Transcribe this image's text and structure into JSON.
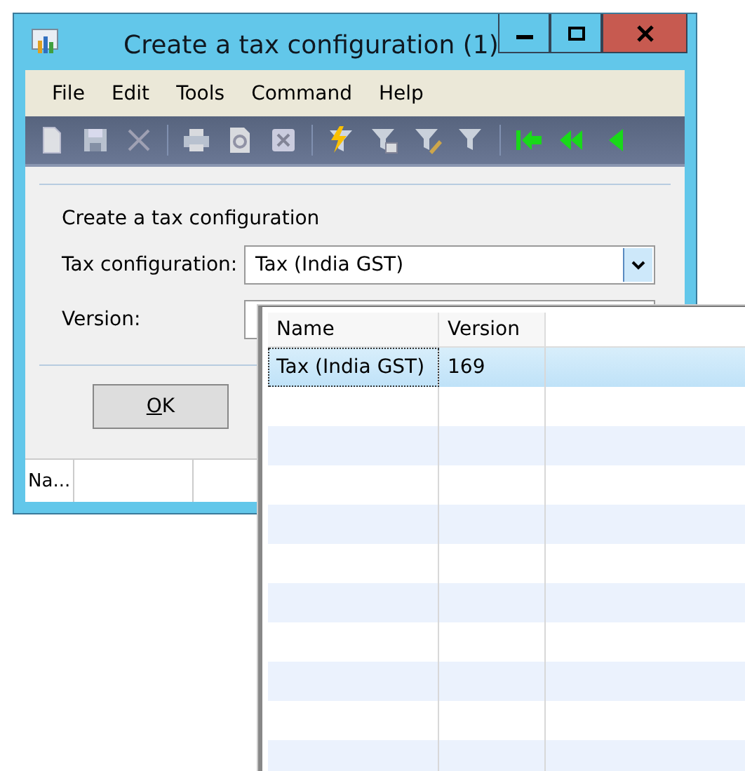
{
  "window": {
    "title": "Create a tax configuration (1)"
  },
  "menu": [
    "File",
    "Edit",
    "Tools",
    "Command",
    "Help"
  ],
  "toolbar": [
    {
      "kind": "new",
      "disabled": true
    },
    {
      "kind": "save",
      "disabled": true
    },
    {
      "kind": "delete",
      "disabled": true
    },
    {
      "kind": "sep"
    },
    {
      "kind": "print",
      "disabled": true
    },
    {
      "kind": "preview",
      "disabled": true
    },
    {
      "kind": "excel",
      "disabled": true
    },
    {
      "kind": "sep"
    },
    {
      "kind": "filter-lightning",
      "disabled": false
    },
    {
      "kind": "filter-grid",
      "disabled": true
    },
    {
      "kind": "filter-edit",
      "disabled": true
    },
    {
      "kind": "filter-clear",
      "disabled": true
    },
    {
      "kind": "sep"
    },
    {
      "kind": "first",
      "disabled": false
    },
    {
      "kind": "prev-page",
      "disabled": false
    },
    {
      "kind": "prev",
      "disabled": false
    }
  ],
  "form": {
    "heading": "Create a tax configuration",
    "fields": [
      {
        "label": "Tax configuration:",
        "value": "Tax (India GST)"
      },
      {
        "label": "Version:"
      }
    ],
    "ok_button": "OK"
  },
  "status_bar": {
    "cells": [
      "Na..."
    ]
  },
  "lookup": {
    "columns": [
      "Name",
      "Version"
    ],
    "rows": [
      {
        "name": "Tax (India GST)",
        "version": "169",
        "selected": true
      }
    ]
  }
}
